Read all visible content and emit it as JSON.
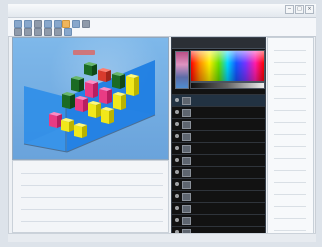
{
  "window": {
    "title": "",
    "controls": {
      "minimize_label": "",
      "maximize_label": "",
      "close_label": ""
    }
  },
  "toolbar": {
    "icons": [
      "save-icon",
      "open-icon",
      "print-icon",
      "undo-icon",
      "redo-icon",
      "zoom-icon",
      "layers-icon",
      "settings-icon"
    ]
  },
  "canvas": {
    "chart_caption": "",
    "axis_labels": [
      "",
      "",
      "",
      "",
      ""
    ]
  },
  "right_panel": {
    "header_label": "",
    "layers": [
      {
        "label": "",
        "active": true
      },
      {
        "label": "",
        "active": false
      },
      {
        "label": "",
        "active": false
      },
      {
        "label": "",
        "active": false
      },
      {
        "label": "",
        "active": false
      },
      {
        "label": "",
        "active": false
      },
      {
        "label": "",
        "active": false
      },
      {
        "label": "",
        "active": false
      },
      {
        "label": "",
        "active": false
      },
      {
        "label": "",
        "active": false
      },
      {
        "label": "",
        "active": false
      },
      {
        "label": "",
        "active": false
      }
    ]
  },
  "colors": {
    "background": "#dde3ea",
    "panel_dark": "#121212",
    "chart_blue": "#6aa3db",
    "chart_green": "#2a7e32",
    "chart_yellow": "#f2e100",
    "chart_pink": "#d93b80",
    "chart_red": "#d83b2d"
  }
}
